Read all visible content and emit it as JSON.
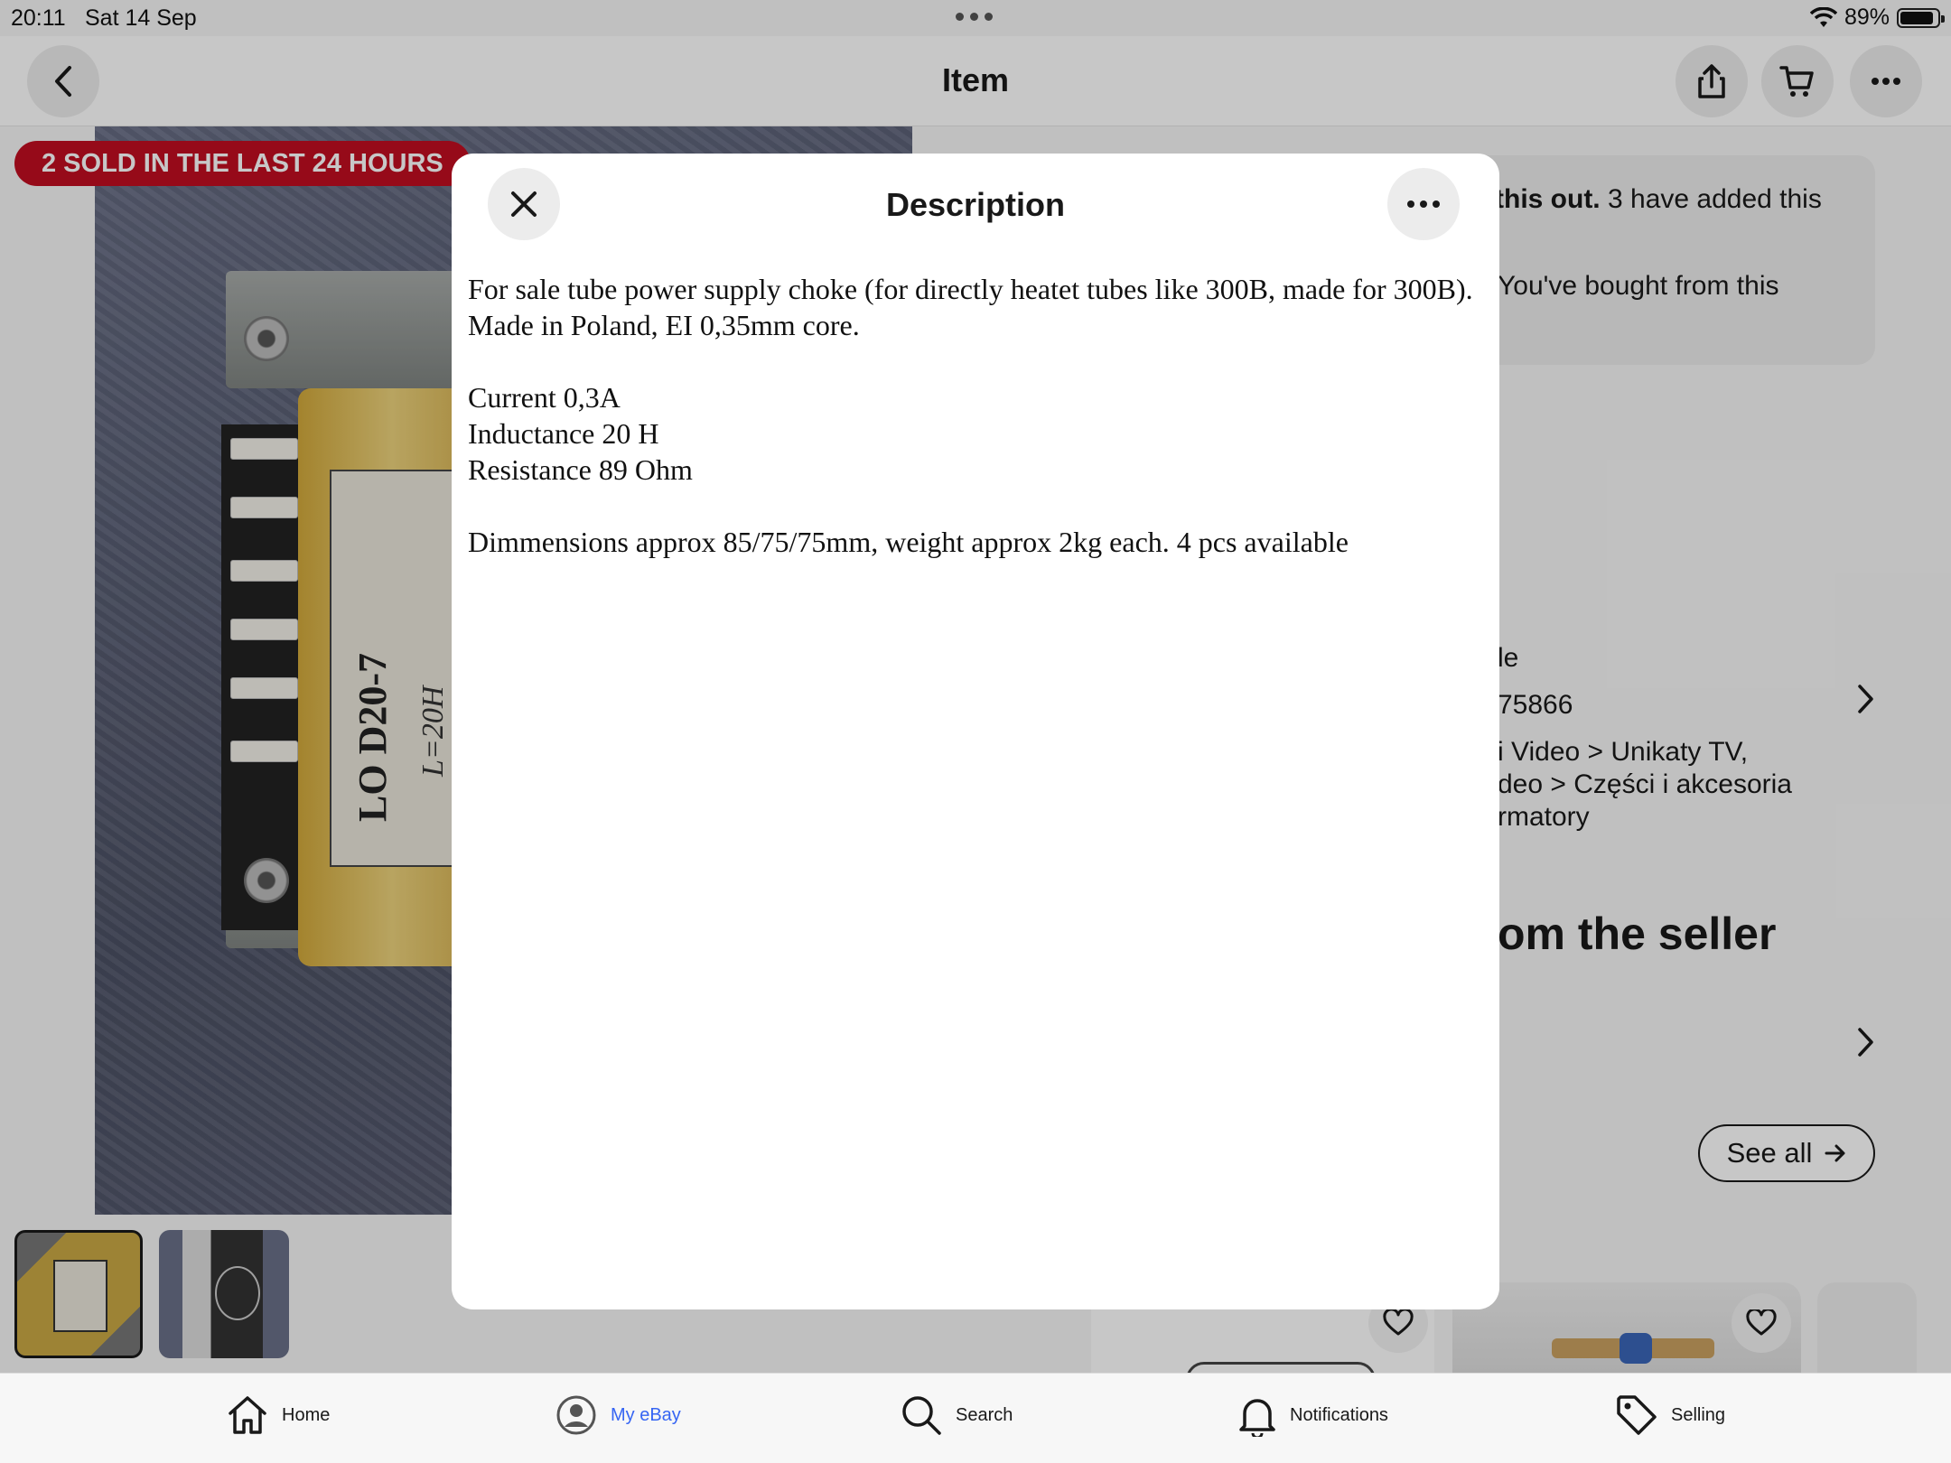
{
  "status_bar": {
    "time": "20:11",
    "date": "Sat 14 Sep",
    "battery": "89%",
    "battery_level": 0.89
  },
  "nav": {
    "title": "Item",
    "icons": [
      "back-icon",
      "share-icon",
      "cart-icon",
      "more-icon"
    ]
  },
  "gallery": {
    "sold_badge": "2 SOLD IN THE LAST 24 HOURS",
    "photo_label": "LO D20-7",
    "photo_sublabel": "L=20H",
    "thumbnail_count": 2,
    "selected_thumbnail": 1
  },
  "background_content": {
    "info_line_1_bold": "this out.",
    "info_line_1_rest": " 3 have added this",
    "info_line_2": "You've bought from this",
    "detail_1": "le",
    "detail_2": "75866",
    "detail_3": "i Video > Unikaty TV,",
    "detail_4": "deo > Części i akcesoria",
    "detail_5": "rmatory",
    "section_heading": "om the seller",
    "see_all": "See all"
  },
  "modal": {
    "title": "Description",
    "paragraph_1": "For sale tube power supply choke (for directly heatet tubes like 300B, made for 300B).\nMade in Poland, EI 0,35mm core.",
    "spec_current": "Current 0,3A",
    "spec_inductance": "Inductance 20 H",
    "spec_resistance": "Resistance 89 Ohm",
    "paragraph_2": "Dimmensions approx 85/75/75mm, weight approx 2kg each. 4 pcs available"
  },
  "tab_bar": {
    "tabs": [
      {
        "label": "Home",
        "icon": "home-icon"
      },
      {
        "label": "My eBay",
        "icon": "profile-icon",
        "active": true
      },
      {
        "label": "Search",
        "icon": "search-icon"
      },
      {
        "label": "Notifications",
        "icon": "bell-icon"
      },
      {
        "label": "Selling",
        "icon": "tag-icon"
      }
    ]
  },
  "colors": {
    "accent": "#3665f3",
    "sold_badge": "#c10e21",
    "text": "#191919"
  }
}
